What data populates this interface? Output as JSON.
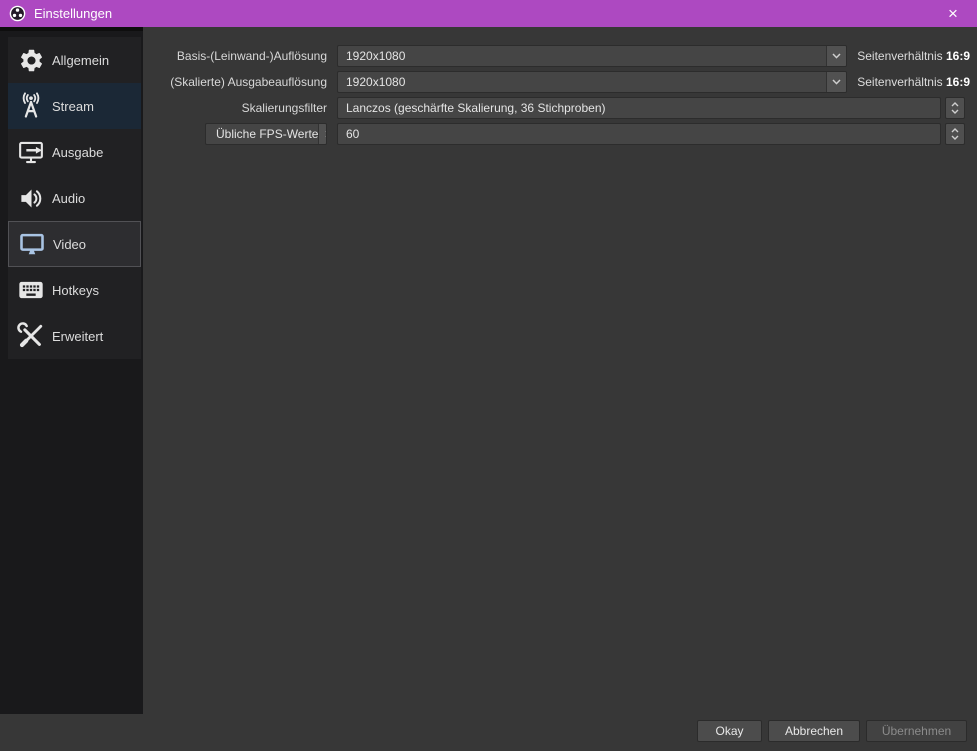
{
  "window": {
    "title": "Einstellungen",
    "close_glyph": "×"
  },
  "sidebar": {
    "items": [
      {
        "label": "Allgemein",
        "icon": "gear-icon",
        "state": "normal"
      },
      {
        "label": "Stream",
        "icon": "antenna-icon",
        "state": "focused"
      },
      {
        "label": "Ausgabe",
        "icon": "monitor-arrow-icon",
        "state": "normal"
      },
      {
        "label": "Audio",
        "icon": "speaker-icon",
        "state": "normal"
      },
      {
        "label": "Video",
        "icon": "monitor-icon",
        "state": "selected"
      },
      {
        "label": "Hotkeys",
        "icon": "keyboard-icon",
        "state": "normal"
      },
      {
        "label": "Erweitert",
        "icon": "tools-icon",
        "state": "normal"
      }
    ]
  },
  "video": {
    "base_resolution": {
      "label": "Basis-(Leinwand-)Auflösung",
      "value": "1920x1080",
      "aspect_label": "Seitenverhältnis",
      "aspect_value": "16:9"
    },
    "output_resolution": {
      "label": "(Skalierte) Ausgabeauflösung",
      "value": "1920x1080",
      "aspect_label": "Seitenverhältnis",
      "aspect_value": "16:9"
    },
    "downscale_filter": {
      "label": "Skalierungsfilter",
      "value": "Lanczos (geschärfte Skalierung, 36 Stichproben)"
    },
    "fps": {
      "type_value": "Übliche FPS-Werte",
      "value": "60"
    }
  },
  "buttons": {
    "okay": "Okay",
    "cancel": "Abbrechen",
    "apply": "Übernehmen"
  },
  "colors": {
    "titlebar": "#ad49c1",
    "window_bg": "#373737",
    "sidebar_bg": "#19191b",
    "focused_item_bg": "#1b2836",
    "selected_item_bg": "#2d2d30",
    "video_icon_blue": "#a9c4e4"
  }
}
